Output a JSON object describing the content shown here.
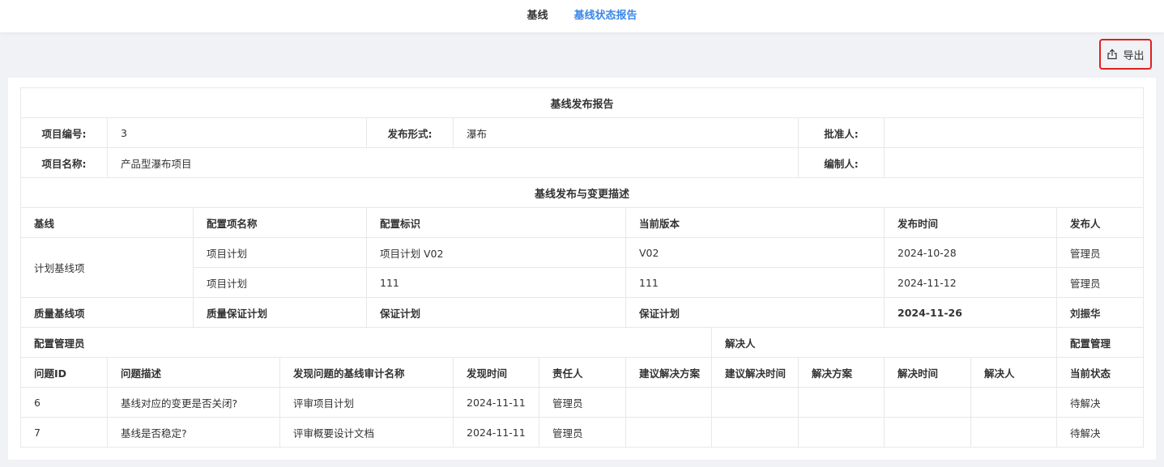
{
  "tabs": [
    {
      "label": "基线"
    },
    {
      "label": "基线状态报告"
    }
  ],
  "toolbar": {
    "export_label": "导出"
  },
  "report": {
    "title": "基线发布报告",
    "info": {
      "project_no_label": "项目编号:",
      "project_no": "3",
      "release_form_label": "发布形式:",
      "release_form": "瀑布",
      "approver_label": "批准人:",
      "approver": "",
      "project_name_label": "项目名称:",
      "project_name": "产品型瀑布项目",
      "compiler_label": "编制人:",
      "compiler": ""
    },
    "section_title": "基线发布与变更描述",
    "baseline_headers": [
      "基线",
      "配置项名称",
      "配置标识",
      "当前版本",
      "发布时间",
      "发布人"
    ],
    "plan_baseline": {
      "name": "计划基线项",
      "rows": [
        [
          "项目计划",
          "项目计划 V02",
          "V02",
          "2024-10-28",
          "管理员"
        ],
        [
          "项目计划",
          "111",
          "111",
          "2024-11-12",
          "管理员"
        ]
      ]
    },
    "quality_baseline": [
      "质量基线项",
      "质量保证计划",
      "保证计划",
      "保证计划",
      "2024-11-26",
      "刘振华"
    ],
    "group_headers": [
      "配置管理员",
      "解决人",
      "配置管理"
    ],
    "issue_headers": [
      "问题ID",
      "问题描述",
      "发现问题的基线审计名称",
      "发现时间",
      "责任人",
      "建议解决方案",
      "建议解决时间",
      "解决方案",
      "解决时间",
      "解决人",
      "当前状态"
    ],
    "issues": [
      [
        "6",
        "基线对应的变更是否关闭?",
        "评审项目计划",
        "2024-11-11",
        "管理员",
        "",
        "",
        "",
        "",
        "",
        "待解决"
      ],
      [
        "7",
        "基线是否稳定?",
        "评审概要设计文档",
        "2024-11-11",
        "管理员",
        "",
        "",
        "",
        "",
        "",
        "待解决"
      ]
    ]
  }
}
